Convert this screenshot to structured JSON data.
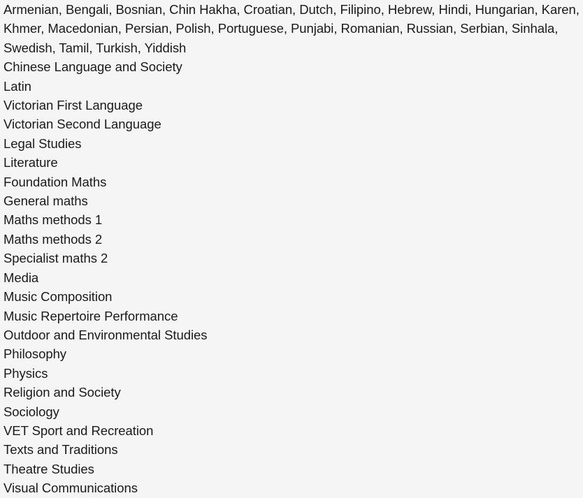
{
  "page": {
    "background_color": "#f5f5f5",
    "text_color": "#1a1a1a"
  },
  "subject_list": {
    "items": [
      "Armenian, Bengali, Bosnian, Chin Hakha, Croatian, Dutch, Filipino, Hebrew, Hindi, Hungarian, Karen, Khmer, Macedonian, Persian, Polish, Portuguese, Punjabi, Romanian, Russian, Serbian, Sinhala, Swedish, Tamil, Turkish, Yiddish",
      "Chinese Language and Society",
      "Latin",
      "Victorian First Language",
      "Victorian Second Language",
      "Legal Studies",
      "Literature",
      "Foundation Maths",
      "General maths",
      "Maths methods 1",
      "Maths methods 2",
      "Specialist maths 2",
      "Media",
      "Music Composition",
      "Music Repertoire Performance",
      "Outdoor and Environmental Studies",
      "Philosophy",
      "Physics",
      "Religion and Society",
      "Sociology",
      "VET Sport and Recreation",
      "Texts and Traditions",
      "Theatre Studies",
      "Visual Communications"
    ]
  }
}
